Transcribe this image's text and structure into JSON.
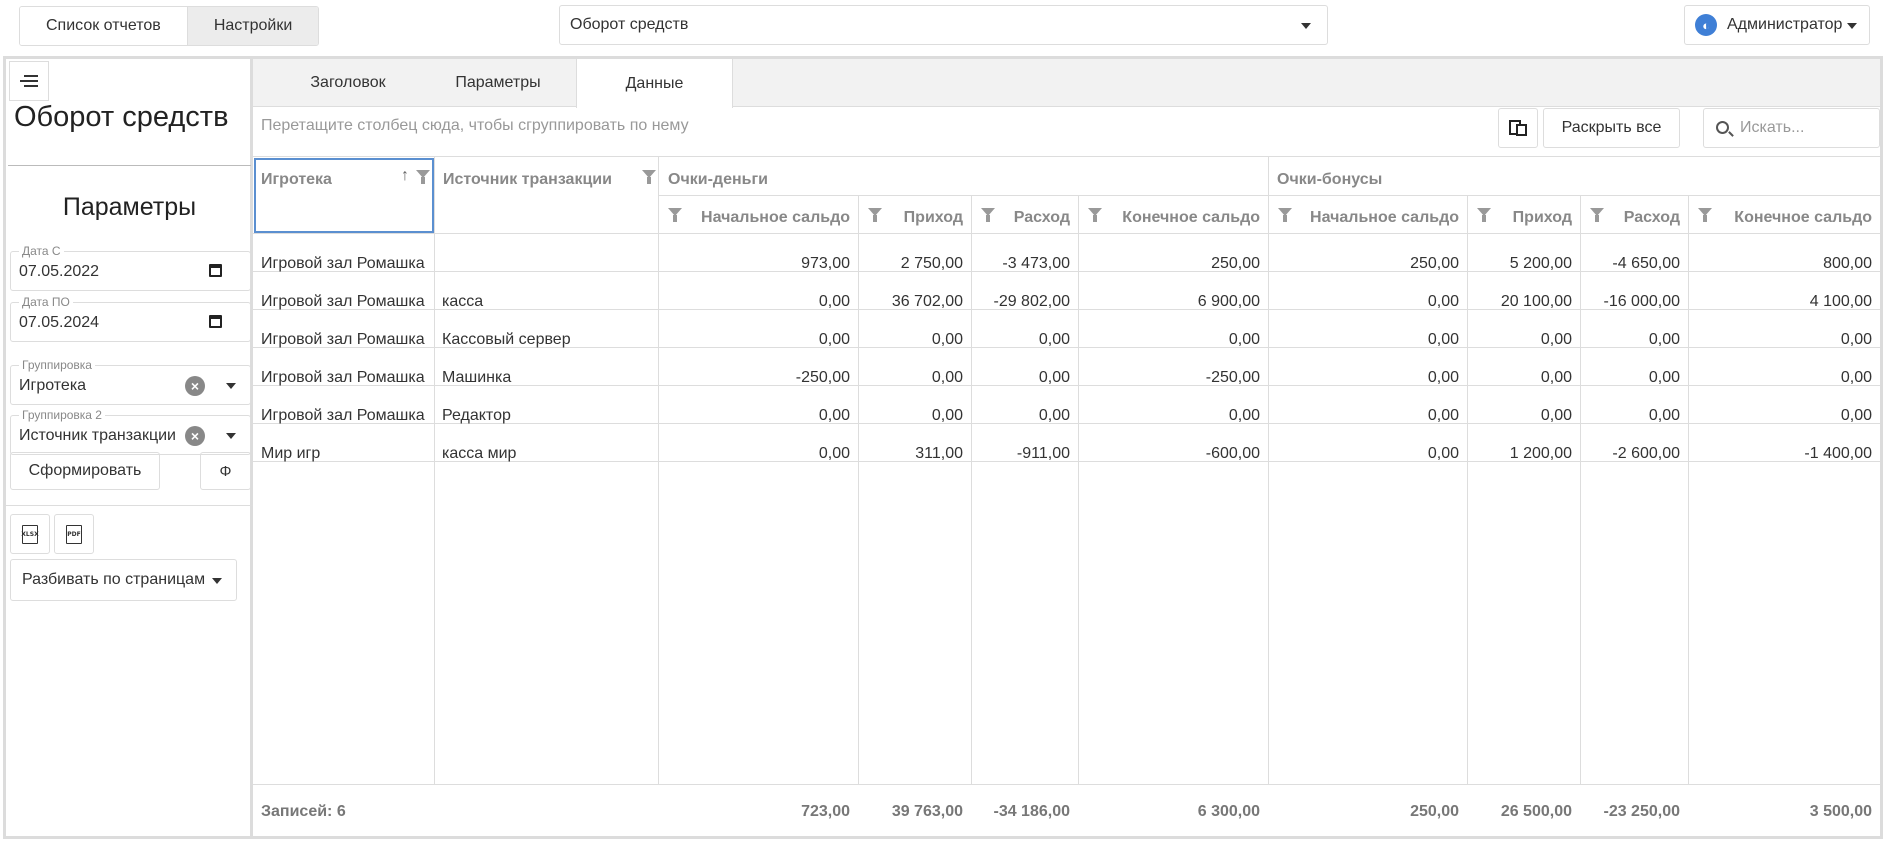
{
  "topbar": {
    "tab_reports": "Список отчетов",
    "tab_settings": "Настройки",
    "report_select": "Оборот средств",
    "user": "Администратор",
    "user_icon": "globe-icon"
  },
  "left": {
    "title": "Оборот средств",
    "params_heading": "Параметры",
    "date_from_label": "Дата С",
    "date_from": "07.05.2022",
    "date_to_label": "Дата ПО",
    "date_to": "07.05.2024",
    "group1_label": "Группировка",
    "group1": "Игротека",
    "group2_label": "Группировка 2",
    "group2": "Источник транзакции",
    "form_button": "Сформировать",
    "fx_button": "Φ",
    "xlsx_icon": "XLSX",
    "pdf_icon": "PDF",
    "paging": "Разбивать по страницам"
  },
  "tabs": [
    "Заголовок",
    "Параметры",
    "Данные"
  ],
  "grid": {
    "group_hint": "Перетащите столбец сюда, чтобы сгруппировать по нему",
    "expand_all": "Раскрыть все",
    "search_placeholder": "Искать...",
    "col_club": "Игротека",
    "col_source": "Источник транзакции",
    "band_money": "Очки-деньги",
    "band_bonus": "Очки-бонусы",
    "sub_cols": [
      "Начальное сальдо",
      "Приход",
      "Расход",
      "Конечное сальдо",
      "Начальное сальдо",
      "Приход",
      "Расход",
      "Конечное сальдо"
    ],
    "rows": [
      [
        "Игровой зал Ромашка",
        "",
        "973,00",
        "2 750,00",
        "-3 473,00",
        "250,00",
        "250,00",
        "5 200,00",
        "-4 650,00",
        "800,00"
      ],
      [
        "Игровой зал Ромашка",
        "касса",
        "0,00",
        "36 702,00",
        "-29 802,00",
        "6 900,00",
        "0,00",
        "20 100,00",
        "-16 000,00",
        "4 100,00"
      ],
      [
        "Игровой зал Ромашка",
        "Кассовый сервер",
        "0,00",
        "0,00",
        "0,00",
        "0,00",
        "0,00",
        "0,00",
        "0,00",
        "0,00"
      ],
      [
        "Игровой зал Ромашка",
        "Машинка",
        "-250,00",
        "0,00",
        "0,00",
        "-250,00",
        "0,00",
        "0,00",
        "0,00",
        "0,00"
      ],
      [
        "Игровой зал Ромашка",
        "Редактор",
        "0,00",
        "0,00",
        "0,00",
        "0,00",
        "0,00",
        "0,00",
        "0,00",
        "0,00"
      ],
      [
        "Мир игр",
        "касса мир",
        "0,00",
        "311,00",
        "-911,00",
        "-600,00",
        "0,00",
        "1 200,00",
        "-2 600,00",
        "-1 400,00"
      ]
    ],
    "footer": [
      "Записей: 6",
      "",
      "723,00",
      "39 763,00",
      "-34 186,00",
      "6 300,00",
      "250,00",
      "26 500,00",
      "-23 250,00",
      "3 500,00"
    ]
  }
}
